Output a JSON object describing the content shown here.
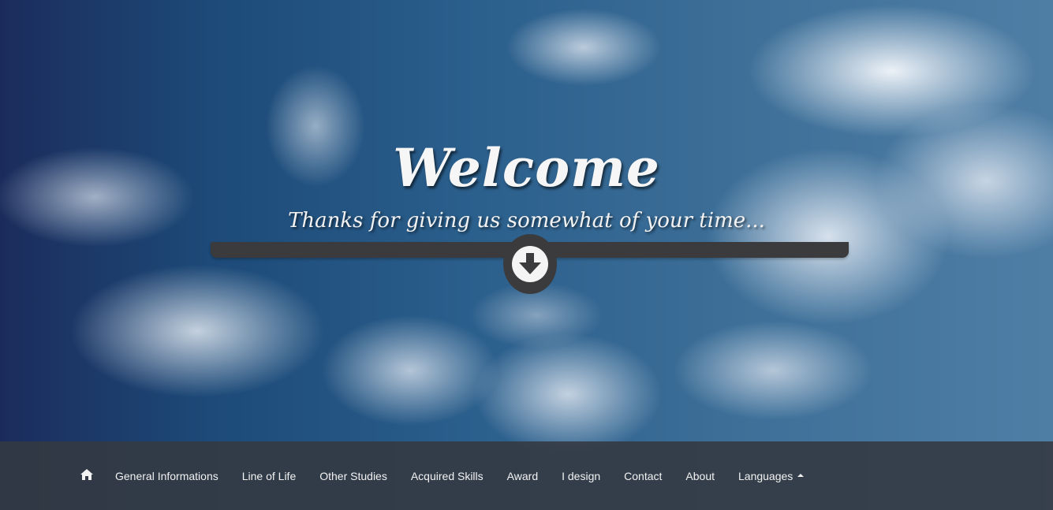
{
  "hero": {
    "title": "Welcome",
    "subtitle": "Thanks for giving us somewhat of your time...",
    "scroll_icon": "arrow-circle-down-icon"
  },
  "nav": {
    "home_icon": "home-icon",
    "items": [
      {
        "label": "General Informations"
      },
      {
        "label": "Line of Life"
      },
      {
        "label": "Other Studies"
      },
      {
        "label": "Acquired Skills"
      },
      {
        "label": "Award"
      },
      {
        "label": "I design"
      },
      {
        "label": "Contact"
      },
      {
        "label": "About"
      },
      {
        "label": "Languages",
        "icon": "caret-up-icon"
      }
    ]
  },
  "colors": {
    "bar": "#3b3b3d",
    "navbar": "#343a42",
    "text": "#f2f2f2"
  }
}
